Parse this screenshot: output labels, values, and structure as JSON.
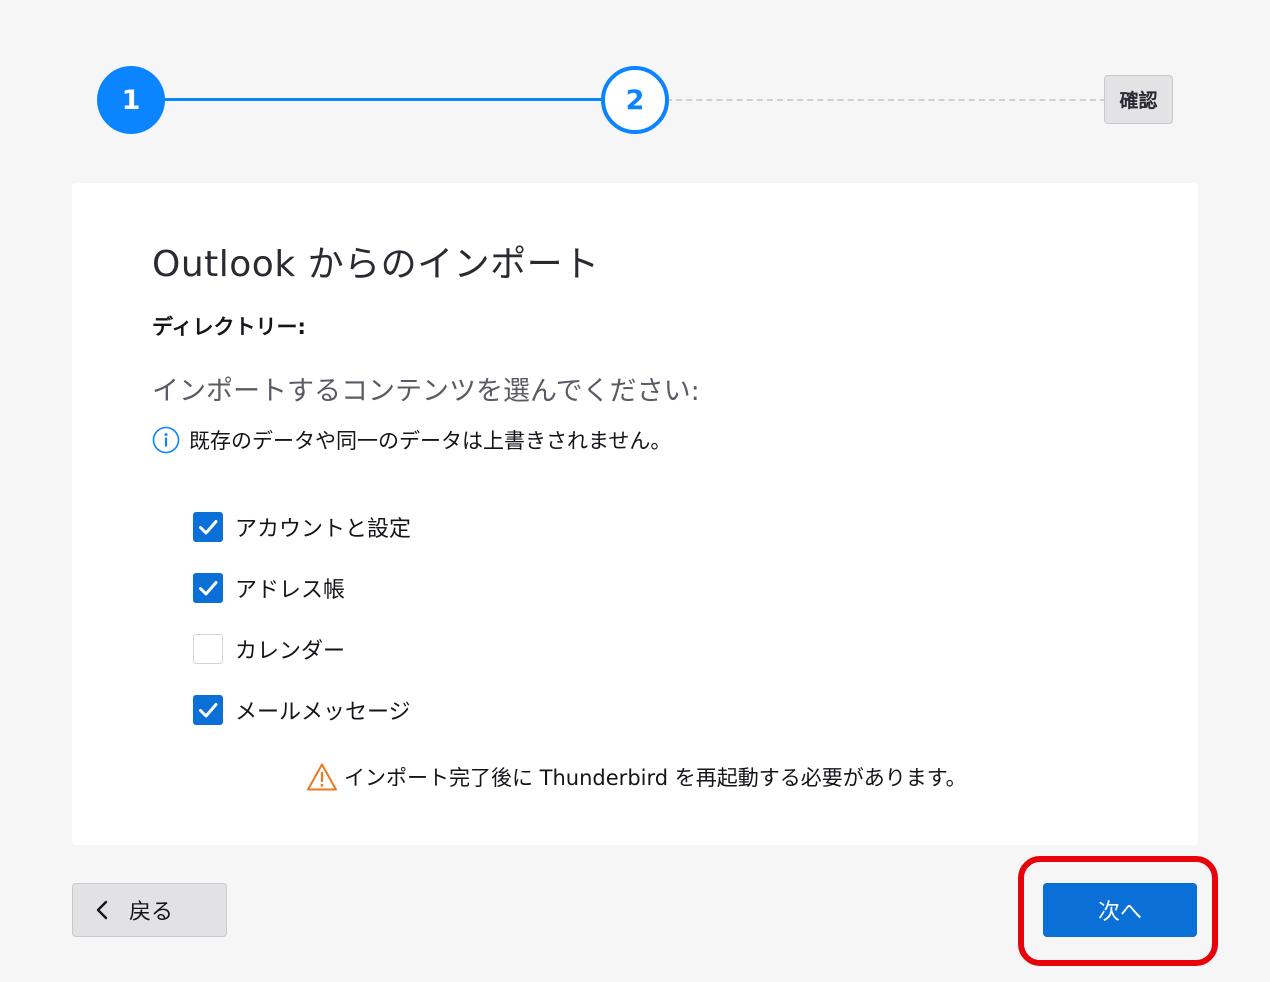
{
  "stepper": {
    "steps": [
      {
        "label": "1",
        "state": "completed"
      },
      {
        "label": "2",
        "state": "current"
      }
    ],
    "final_step_label": "確認",
    "accent_color": "#0a84ff"
  },
  "main": {
    "title": "Outlook からのインポート",
    "directory_label": "ディレクトリー:",
    "select_prompt": "インポートするコンテンツを選んでください:",
    "info_icon": "info-icon",
    "info_note": "既存のデータや同一のデータは上書きされません。",
    "options": [
      {
        "label": "アカウントと設定",
        "checked": true
      },
      {
        "label": "アドレス帳",
        "checked": true
      },
      {
        "label": "カレンダー",
        "checked": false
      },
      {
        "label": "メールメッセージ",
        "checked": true
      }
    ],
    "warning_icon": "warning-icon",
    "warning_note": "インポート完了後に Thunderbird を再起動する必要があります。"
  },
  "footer": {
    "back_icon": "chevron-left-icon",
    "back_label": "戻る",
    "next_label": "次へ",
    "primary_color": "#0a6fd6",
    "highlight_color": "#e8000b"
  }
}
